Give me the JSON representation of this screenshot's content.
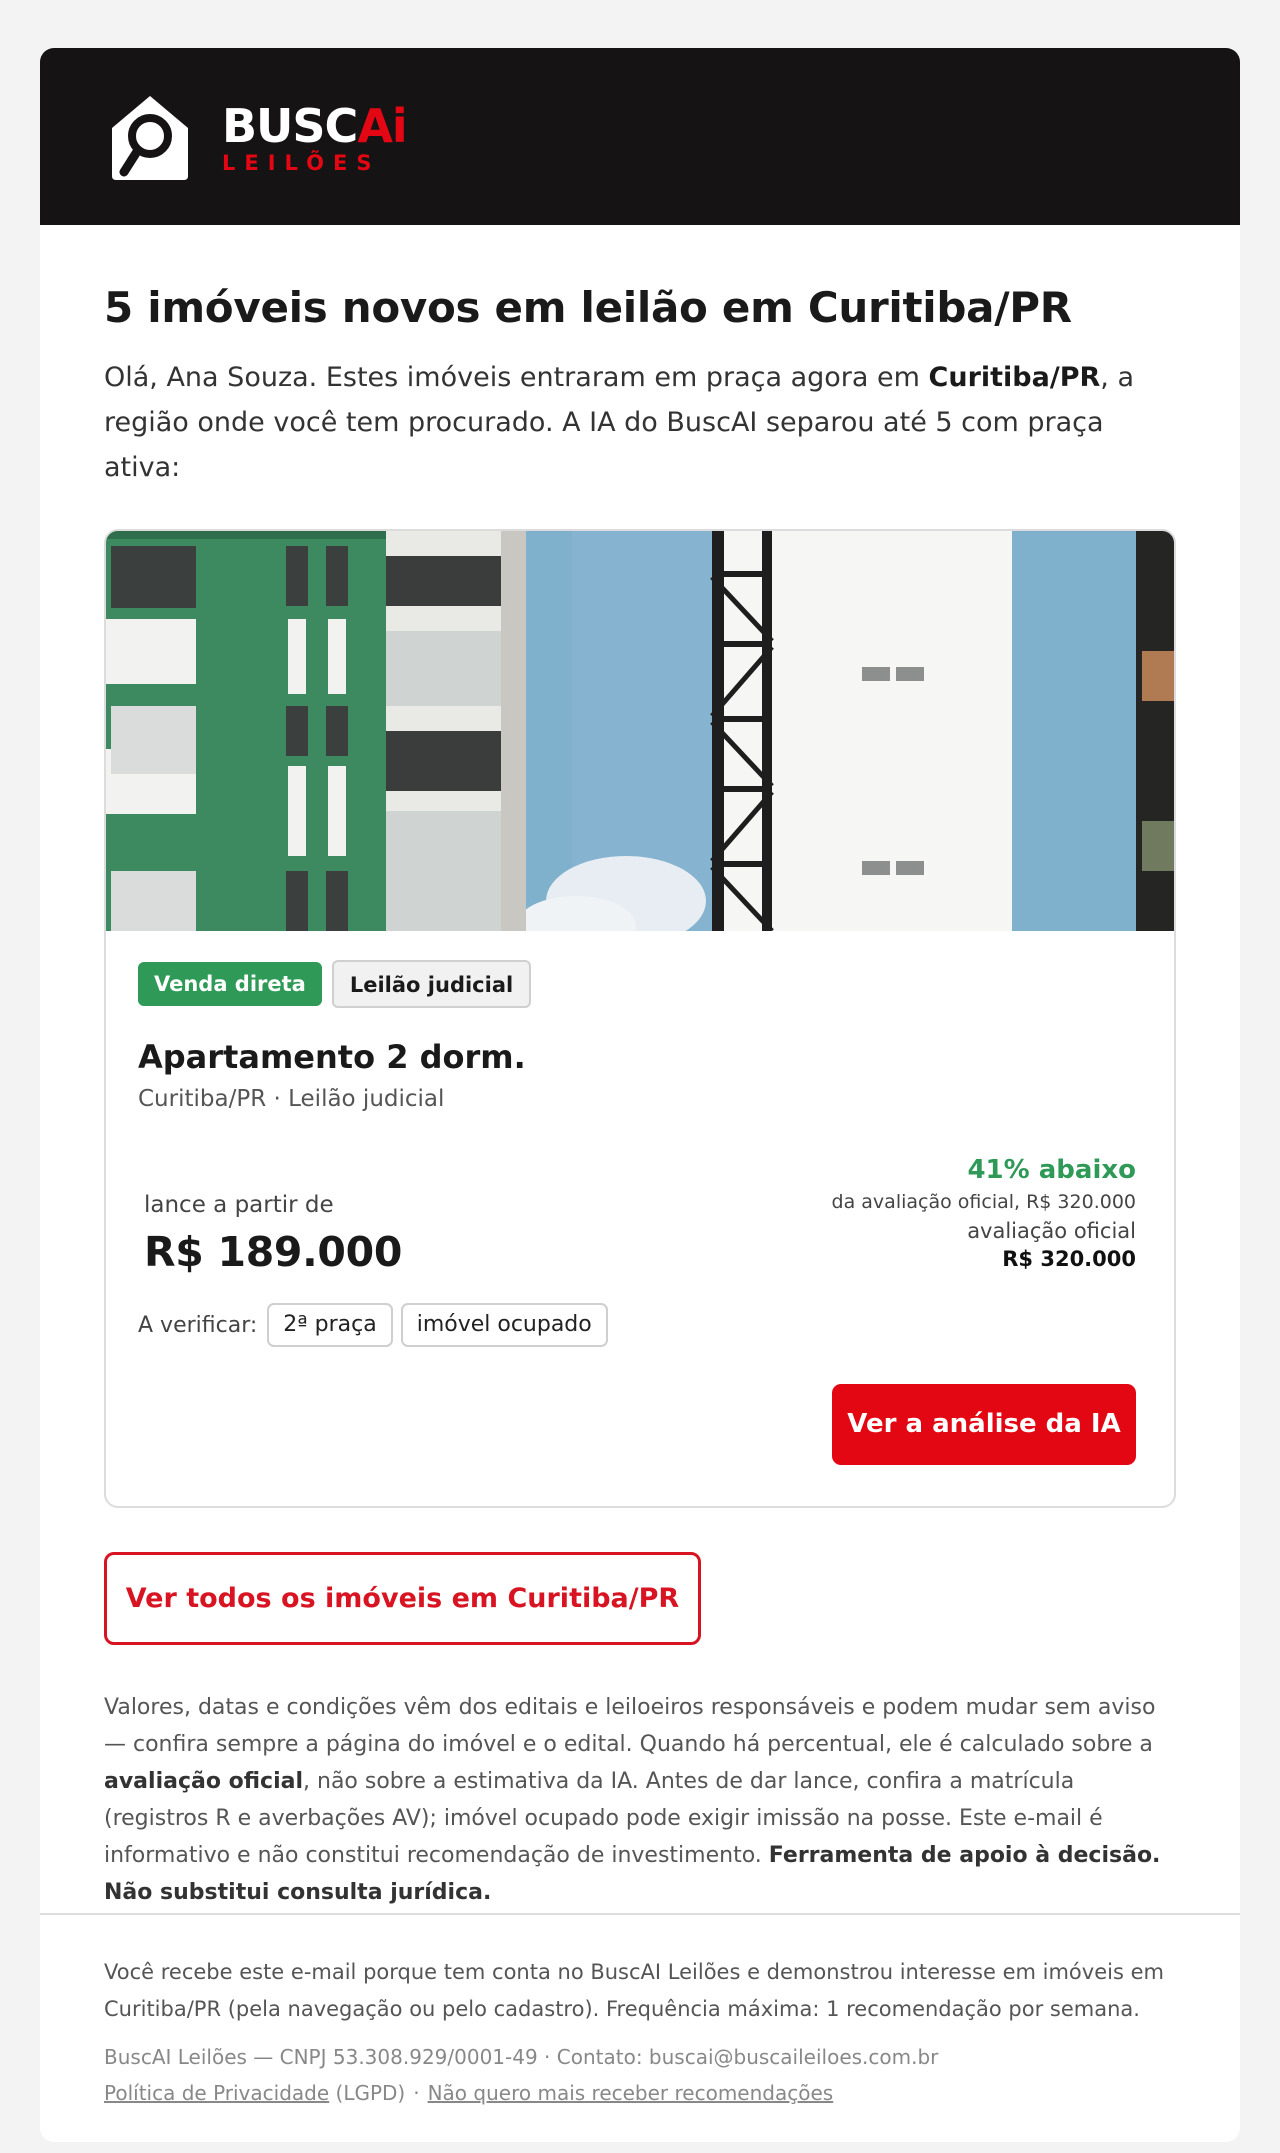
{
  "brand": {
    "name_main": "BUSC",
    "name_ai": "Ai",
    "name_sub": "LEILÕES",
    "red": "#e30613",
    "green": "#2f9a57",
    "dark": "#161314"
  },
  "headline": "5 imóveis novos em leilão em Curitiba/PR",
  "intro": {
    "part1": "Olá, Ana Souza. Estes imóveis entraram em praça agora em ",
    "city": "Curitiba/PR",
    "part2": ", a região onde você tem procurado. A IA do BuscAI separou até 5 com praça ativa:"
  },
  "listing": {
    "tags": [
      "Venda direta",
      "Leilão judicial"
    ],
    "title": "Apartamento 2 dorm.",
    "subtitle": "Curitiba/PR · Leilão judicial",
    "price_label": "lance a partir de",
    "price": "R$ 189.000",
    "discount_pct": "41% abaixo",
    "discount_note": "da avaliação oficial, R$ 320.000",
    "aval_label": "avaliação oficial",
    "aval_value": "R$ 320.000",
    "verify_label": "A verificar:",
    "verify_chips": [
      "2ª praça",
      "imóvel ocupado"
    ],
    "cta": "Ver a análise da IA"
  },
  "see_all": "Ver todos os imóveis em Curitiba/PR",
  "disclaimer": {
    "p1": "Valores, datas e condições vêm dos editais e leiloeiros responsáveis e podem mudar sem aviso — confira sempre a página do imóvel e o edital. Quando há percentual, ele é calculado sobre a ",
    "b1": "avaliação oficial",
    "p2": ", não sobre a estimativa da IA. Antes de dar lance, confira a matrícula (registros R e averbações AV); imóvel ocupado pode exigir imissão na posse. Este e-mail é informativo e não constitui recomendação de investimento. ",
    "b2": "Ferramenta de apoio à decisão. Não substitui consulta jurídica."
  },
  "footer": {
    "why": "Você recebe este e-mail porque tem conta no BuscAI Leilões e demonstrou interesse em imóveis em Curitiba/PR (pela navegação ou pelo cadastro). Frequência máxima: 1 recomendação por semana.",
    "company": "BuscAI Leilões — CNPJ 53.308.929/0001-49 · Contato: buscai@buscaileiloes.com.br",
    "privacy_link": "Política de Privacidade",
    "privacy_suffix": " (LGPD)",
    "separator": "·",
    "unsubscribe_link": "Não quero mais receber recomendações"
  }
}
